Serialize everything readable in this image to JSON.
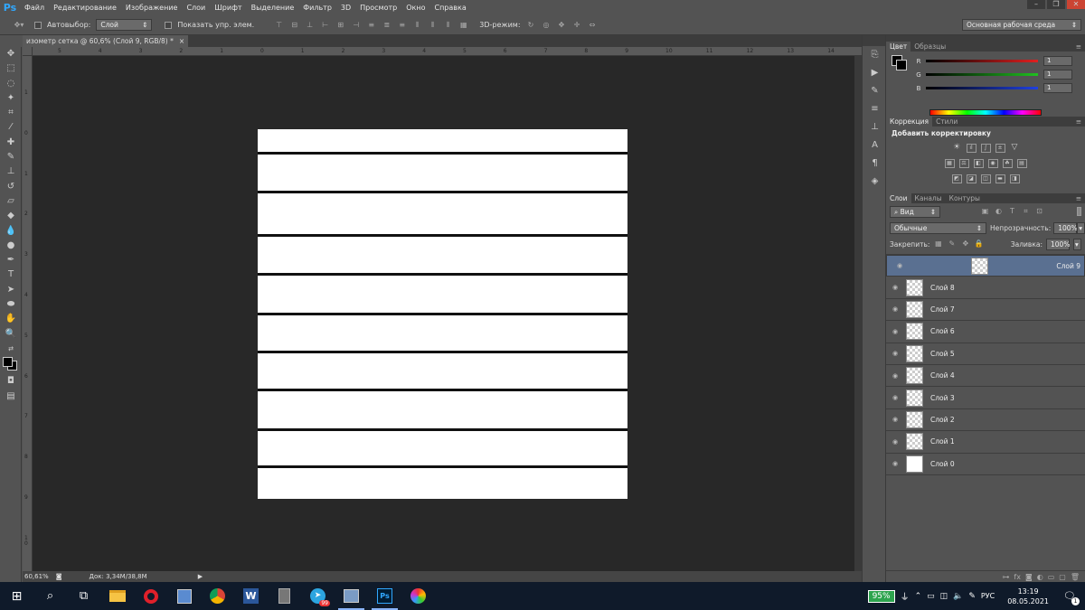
{
  "menubar": {
    "logo": "Ps",
    "items": [
      "Файл",
      "Редактирование",
      "Изображение",
      "Слои",
      "Шрифт",
      "Выделение",
      "Фильтр",
      "3D",
      "Просмотр",
      "Окно",
      "Справка"
    ]
  },
  "options": {
    "autoselect_label": "Автовыбор:",
    "autoselect_value": "Слой",
    "show_transform_label": "Показать упр. элем.",
    "mode3d_label": "3D-режим:",
    "workspace_value": "Основная рабочая среда"
  },
  "document": {
    "tab_title": "изометр сетка @ 60,6% (Слой 9, RGB/8) *",
    "close": "×",
    "zoom": "60,61%",
    "doc_info": "Док: 3,34M/38,8M"
  },
  "ruler_top": [
    "5",
    "4",
    "3",
    "2",
    "1",
    "0",
    "1",
    "2",
    "3",
    "4",
    "5",
    "6",
    "7",
    "8",
    "9",
    "10",
    "11",
    "12",
    "13",
    "14"
  ],
  "ruler_left": [
    "1",
    "0",
    "1",
    "2",
    "3",
    "4",
    "5",
    "6",
    "7",
    "8",
    "9",
    "1\n0"
  ],
  "color_panel": {
    "tabs": [
      "Цвет",
      "Образцы"
    ],
    "channels": [
      {
        "label": "R",
        "value": "1",
        "color": "#e02020"
      },
      {
        "label": "G",
        "value": "1",
        "color": "#20c020"
      },
      {
        "label": "B",
        "value": "1",
        "color": "#2040e0"
      }
    ]
  },
  "adjust_panel": {
    "tabs": [
      "Коррекция",
      "Стили"
    ],
    "title": "Добавить корректировку"
  },
  "layers_panel": {
    "tabs": [
      "Слои",
      "Каналы",
      "Контуры"
    ],
    "filter_value": "Вид",
    "blend_value": "Обычные",
    "opacity_label": "Непрозрачность:",
    "opacity_value": "100%",
    "lock_label": "Закрепить:",
    "fill_label": "Заливка:",
    "fill_value": "100%",
    "layers": [
      {
        "name": "Слой 9",
        "selected": true
      },
      {
        "name": "Слой 8"
      },
      {
        "name": "Слой 7"
      },
      {
        "name": "Слой 6"
      },
      {
        "name": "Слой 5"
      },
      {
        "name": "Слой 4"
      },
      {
        "name": "Слой 3"
      },
      {
        "name": "Слой 2"
      },
      {
        "name": "Слой 1"
      },
      {
        "name": "Слой 0",
        "solid": true
      }
    ]
  },
  "taskbar": {
    "battery": "95%",
    "lang": "РУС",
    "time": "13:19",
    "date": "08.05.2021",
    "telegram_badge": "99",
    "notif_count": "1"
  }
}
